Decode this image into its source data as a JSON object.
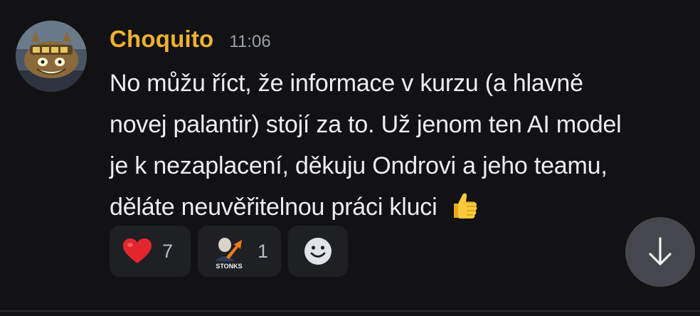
{
  "message": {
    "author": "Choquito",
    "timestamp": "11:06",
    "lines": [
      "No můžu říct, že informace v kurzu (a hlavně",
      "novej palantir) stojí za to. Už jenom ten AI model",
      "je k nezaplacení, děkuju Ondrovi a jeho teamu,",
      "děláte neuvěřitelnou práci kluci"
    ],
    "emoji": "thumbs-up",
    "reactions": [
      {
        "emoji": "heart",
        "count": "7"
      },
      {
        "emoji": "stonks",
        "label": "STONKS",
        "count": "1"
      }
    ],
    "add_reaction_icon": "smile-icon"
  },
  "scroll": {
    "icon": "arrow-down-icon"
  },
  "colors": {
    "background": "#121214",
    "username": "#f0b232",
    "timestamp": "#9aa0ab",
    "reaction_bg": "#1f2024",
    "scroll_bg": "#46474e"
  }
}
